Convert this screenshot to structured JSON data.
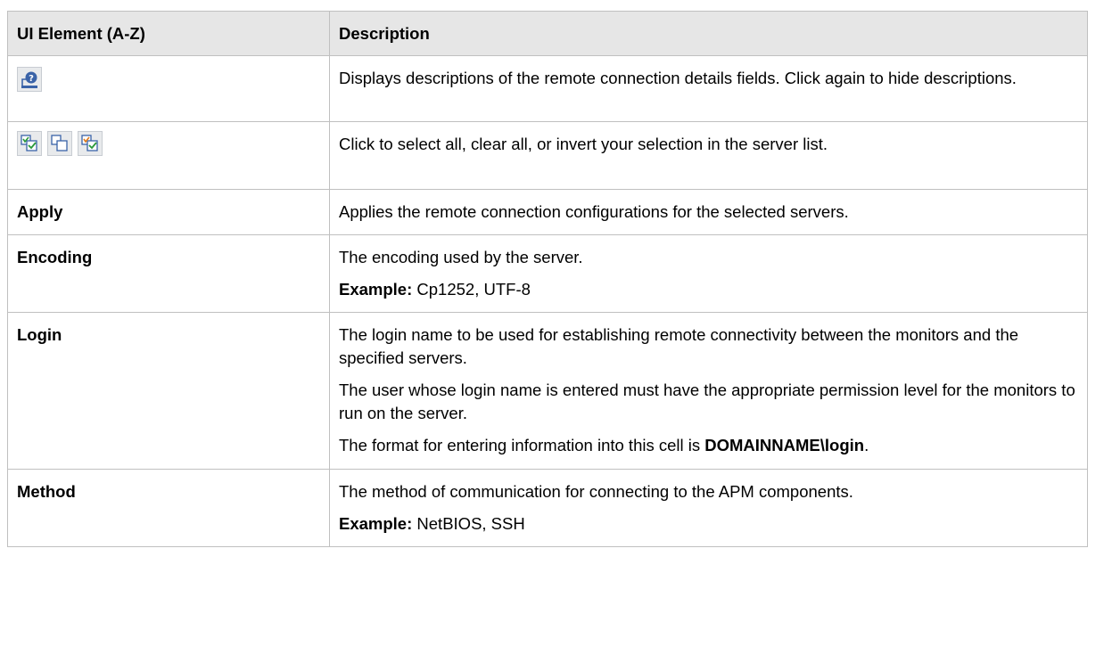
{
  "table": {
    "headers": [
      "UI Element (A-Z)",
      "Description"
    ],
    "rows": {
      "help": {
        "icon": "help-description-icon",
        "description": "Displays descriptions of the remote connection details fields. Click again to hide descriptions."
      },
      "select": {
        "icons": [
          "select-all-icon",
          "clear-all-icon",
          "invert-selection-icon"
        ],
        "description": "Click to select all, clear all, or invert your selection in the server list."
      },
      "apply": {
        "name": "Apply",
        "description": "Applies the remote connection configurations for the selected servers."
      },
      "encoding": {
        "name": "Encoding",
        "description": "The encoding used by the server.",
        "example_label": "Example:",
        "example_value": " Cp1252, UTF-8"
      },
      "login": {
        "name": "Login",
        "description_1": "The login name to be used for establishing remote connectivity between the monitors and the specified servers.",
        "description_2": "The user whose login name is entered must have the appropriate permission level for the monitors to run on the server.",
        "description_3_prefix": "The format for entering information into this cell is ",
        "description_3_bold": "DOMAINNAME\\login",
        "description_3_suffix": "."
      },
      "method": {
        "name": "Method",
        "description": "The method of communication for connecting to the APM components.",
        "example_label": "Example:",
        "example_value": " NetBIOS, SSH"
      }
    }
  },
  "colors": {
    "header_bg": "#e6e6e6",
    "border": "#c0c0c0",
    "icon_bg": "#e8eaec",
    "icon_blue": "#3a63a8",
    "icon_green": "#2a9a3a",
    "icon_orange": "#e07a1a"
  }
}
